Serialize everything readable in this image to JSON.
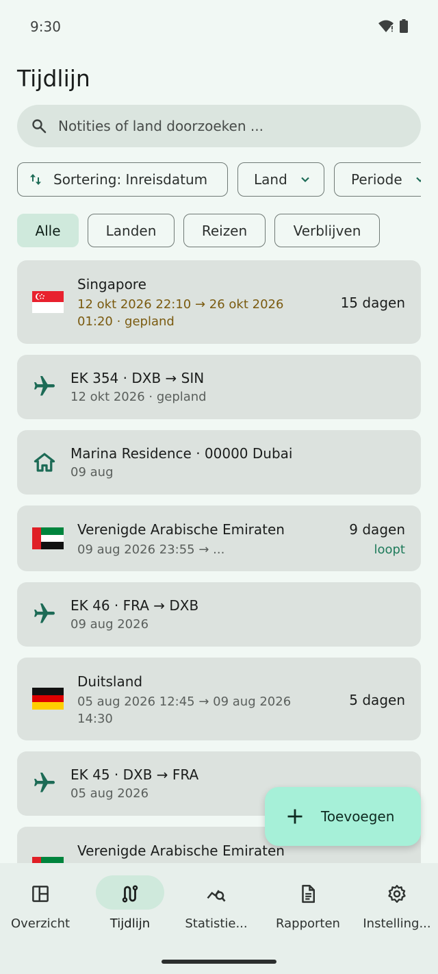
{
  "status": {
    "time": "9:30"
  },
  "page": {
    "title": "Tijdlijn"
  },
  "search": {
    "placeholder": "Notities of land doorzoeken ..."
  },
  "sort_chips": {
    "sort_label": "Sortering: Inreisdatum",
    "land_label": "Land",
    "periode_label": "Periode"
  },
  "filters": [
    "Alle",
    "Landen",
    "Reizen",
    "Verblijven"
  ],
  "colors": {
    "accent": "#1d6b56",
    "planned": "#7a5a0f",
    "running": "#1d7a5a",
    "fab": "#a6f0d8"
  },
  "timeline": [
    {
      "kind": "country",
      "flag": "singapore-flag-icon",
      "name": "Singapore",
      "line1": "12 okt 2026 22:10  →  26 okt 2026",
      "line2": "01:20 · gepland",
      "duration": "15 dagen"
    },
    {
      "kind": "flight",
      "icon": "airplane-icon",
      "title": "EK 354 · DXB → SIN",
      "sub": "12 okt 2026 · gepland"
    },
    {
      "kind": "stay",
      "icon": "home-icon",
      "title": "Marina Residence · 00000 Dubai",
      "sub": "09 aug"
    },
    {
      "kind": "country",
      "flag": "uae-flag-icon",
      "name": "Verenigde Arabische Emiraten",
      "line1": "09 aug 2026 23:55  →  ...",
      "duration": "9 dagen",
      "status": "loopt"
    },
    {
      "kind": "flight",
      "icon": "airplane-icon",
      "title": "EK 46 · FRA → DXB",
      "sub": "09 aug 2026"
    },
    {
      "kind": "country",
      "flag": "germany-flag-icon",
      "name": "Duitsland",
      "line1": "05 aug 2026 12:45  →  09 aug 2026",
      "line2": "14:30",
      "duration": "5 dagen"
    },
    {
      "kind": "flight",
      "icon": "airplane-icon",
      "title": "EK 45 · DXB → FRA",
      "sub": "05 aug 2026"
    },
    {
      "kind": "country",
      "flag": "uae-flag-icon",
      "name": "Verenigde Arabische Emiraten"
    }
  ],
  "fab": {
    "label": "Toevoegen",
    "icon": "plus-icon"
  },
  "nav": [
    {
      "label": "Overzicht",
      "icon": "dashboard-icon"
    },
    {
      "label": "Tijdlijn",
      "icon": "route-icon",
      "selected": true
    },
    {
      "label": "Statistie...",
      "icon": "query-stats-icon"
    },
    {
      "label": "Rapporten",
      "icon": "document-icon"
    },
    {
      "label": "Instelling...",
      "icon": "gear-icon"
    }
  ]
}
